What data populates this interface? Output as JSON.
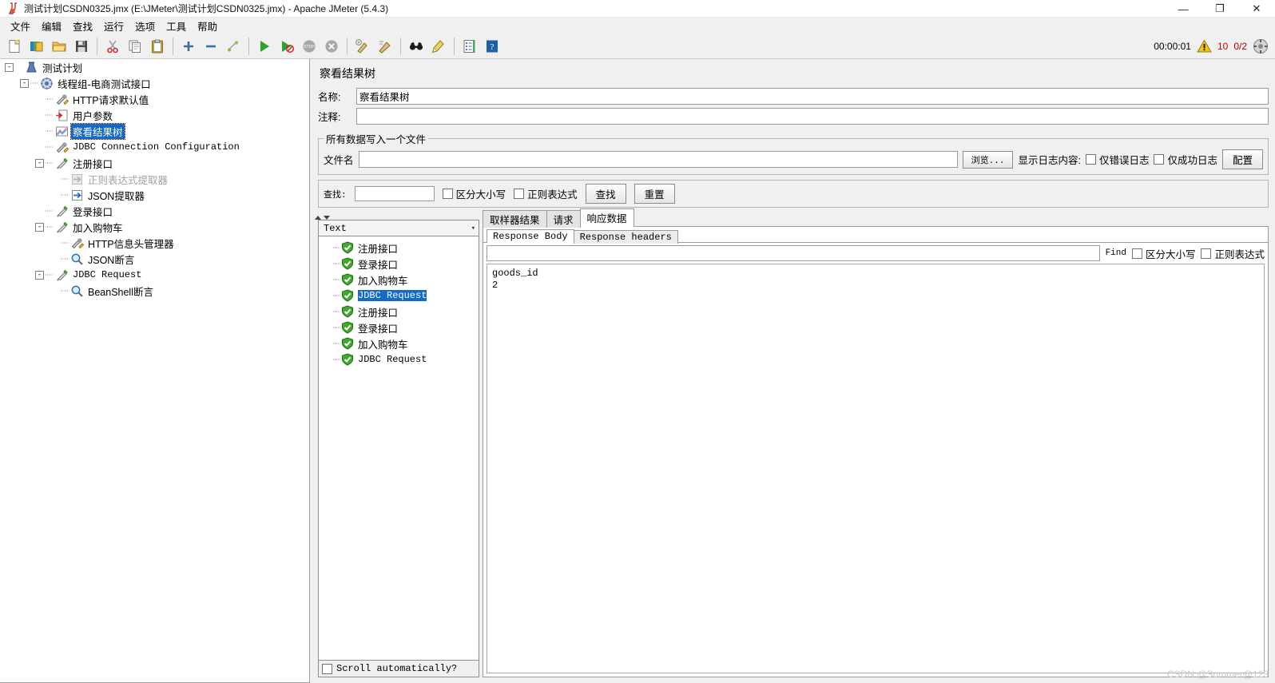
{
  "window": {
    "title": "测试计划CSDN0325.jmx (E:\\JMeter\\测试计划CSDN0325.jmx) - Apache JMeter (5.4.3)",
    "minimize": "—",
    "maximize": "❐",
    "close": "✕"
  },
  "menu": [
    "文件",
    "编辑",
    "查找",
    "运行",
    "选项",
    "工具",
    "帮助"
  ],
  "toolbar": {
    "icons": [
      "new-icon",
      "templates-icon",
      "open-icon",
      "save-icon",
      "cut-icon",
      "copy-icon",
      "paste-icon",
      "expand-icon",
      "collapse-icon",
      "toggle-icon",
      "start-icon",
      "start-no-pauses-icon",
      "stop-icon",
      "shutdown-icon",
      "clear-icon",
      "clear-all-icon",
      "search-icon",
      "reset-search-icon",
      "function-helper-icon",
      "help-icon"
    ],
    "timer": "00:00:01",
    "warn_icon": "warning-icon",
    "warn_count": "10",
    "threads": "0/2",
    "resize_icon": "resize-icon"
  },
  "tree": {
    "nodes": [
      {
        "label": "测试计划",
        "icon": "test-plan-icon",
        "depth": 0,
        "handle": "-",
        "mono": false,
        "selected": false,
        "dim": false
      },
      {
        "label": "线程组-电商测试接口",
        "icon": "thread-group-icon",
        "depth": 1,
        "handle": "-",
        "mono": false,
        "selected": false,
        "dim": false
      },
      {
        "label": "HTTP请求默认值",
        "icon": "config-icon",
        "depth": 2,
        "handle": "",
        "mono": false,
        "selected": false,
        "dim": false
      },
      {
        "label": "用户参数",
        "icon": "user-params-icon",
        "depth": 2,
        "handle": "",
        "mono": false,
        "selected": false,
        "dim": false
      },
      {
        "label": "察看结果树",
        "icon": "view-results-tree-icon",
        "depth": 2,
        "handle": "",
        "mono": false,
        "selected": true,
        "dim": false
      },
      {
        "label": "JDBC Connection Configuration",
        "icon": "config-icon",
        "depth": 2,
        "handle": "",
        "mono": true,
        "selected": false,
        "dim": false
      },
      {
        "label": "注册接口",
        "icon": "sampler-icon",
        "depth": 2,
        "handle": "-",
        "mono": false,
        "selected": false,
        "dim": false
      },
      {
        "label": "正则表达式提取器",
        "icon": "post-processor-disabled-icon",
        "depth": 3,
        "handle": "",
        "mono": false,
        "selected": false,
        "dim": true
      },
      {
        "label": "JSON提取器",
        "icon": "post-processor-icon",
        "depth": 3,
        "handle": "",
        "mono": false,
        "selected": false,
        "dim": false
      },
      {
        "label": "登录接口",
        "icon": "sampler-icon",
        "depth": 2,
        "handle": "",
        "mono": false,
        "selected": false,
        "dim": false
      },
      {
        "label": "加入购物车",
        "icon": "sampler-icon",
        "depth": 2,
        "handle": "-",
        "mono": false,
        "selected": false,
        "dim": false
      },
      {
        "label": "HTTP信息头管理器",
        "icon": "config-icon",
        "depth": 3,
        "handle": "",
        "mono": false,
        "selected": false,
        "dim": false
      },
      {
        "label": "JSON断言",
        "icon": "assertion-icon",
        "depth": 3,
        "handle": "",
        "mono": false,
        "selected": false,
        "dim": false
      },
      {
        "label": "JDBC Request",
        "icon": "sampler-icon",
        "depth": 2,
        "handle": "-",
        "mono": true,
        "selected": false,
        "dim": false
      },
      {
        "label": "BeanShell断言",
        "icon": "assertion-icon",
        "depth": 3,
        "handle": "",
        "mono": false,
        "selected": false,
        "dim": false
      }
    ]
  },
  "panel": {
    "title": "察看结果树",
    "name_label": "名称:",
    "name_value": "察看结果树",
    "comment_label": "注释:",
    "comment_value": "",
    "file_group_legend": "所有数据写入一个文件",
    "filename_label": "文件名",
    "filename_value": "",
    "browse_button": "浏览...",
    "log_display_label": "显示日志内容:",
    "errors_only": "仅错误日志",
    "success_only": "仅成功日志",
    "configure_button": "配置"
  },
  "search": {
    "label": "查找:",
    "value": "",
    "case_sensitive": "区分大小写",
    "regex": "正则表达式",
    "find_button": "查找",
    "reset_button": "重置"
  },
  "results": {
    "renderer": "Text",
    "items": [
      {
        "label": "注册接口",
        "mono": false,
        "selected": false,
        "status": "success"
      },
      {
        "label": "登录接口",
        "mono": false,
        "selected": false,
        "status": "success"
      },
      {
        "label": "加入购物车",
        "mono": false,
        "selected": false,
        "status": "success"
      },
      {
        "label": "JDBC Request",
        "mono": true,
        "selected": true,
        "status": "success"
      },
      {
        "label": "注册接口",
        "mono": false,
        "selected": false,
        "status": "success"
      },
      {
        "label": "登录接口",
        "mono": false,
        "selected": false,
        "status": "success"
      },
      {
        "label": "加入购物车",
        "mono": false,
        "selected": false,
        "status": "success"
      },
      {
        "label": "JDBC Request",
        "mono": true,
        "selected": false,
        "status": "success"
      }
    ],
    "scroll_label": "Scroll automatically?"
  },
  "detail": {
    "tabs": [
      {
        "label": "取样器结果",
        "active": false
      },
      {
        "label": "请求",
        "active": false
      },
      {
        "label": "响应数据",
        "active": true
      }
    ],
    "subtabs": [
      {
        "label": "Response Body",
        "active": true
      },
      {
        "label": "Response headers",
        "active": false
      }
    ],
    "find_value": "",
    "find_label": "Find",
    "find_case": "区分大小写",
    "find_regex": "正则表达式",
    "body": "goods_id\n2"
  },
  "watermark": "CSDN @Summer@123",
  "colors": {
    "selection_blue": "#1569c7",
    "panel_bg": "#f0f0f0",
    "field_bg": "#ffffff",
    "warn_red": "#d00000",
    "success_green": "#4caf2f"
  }
}
